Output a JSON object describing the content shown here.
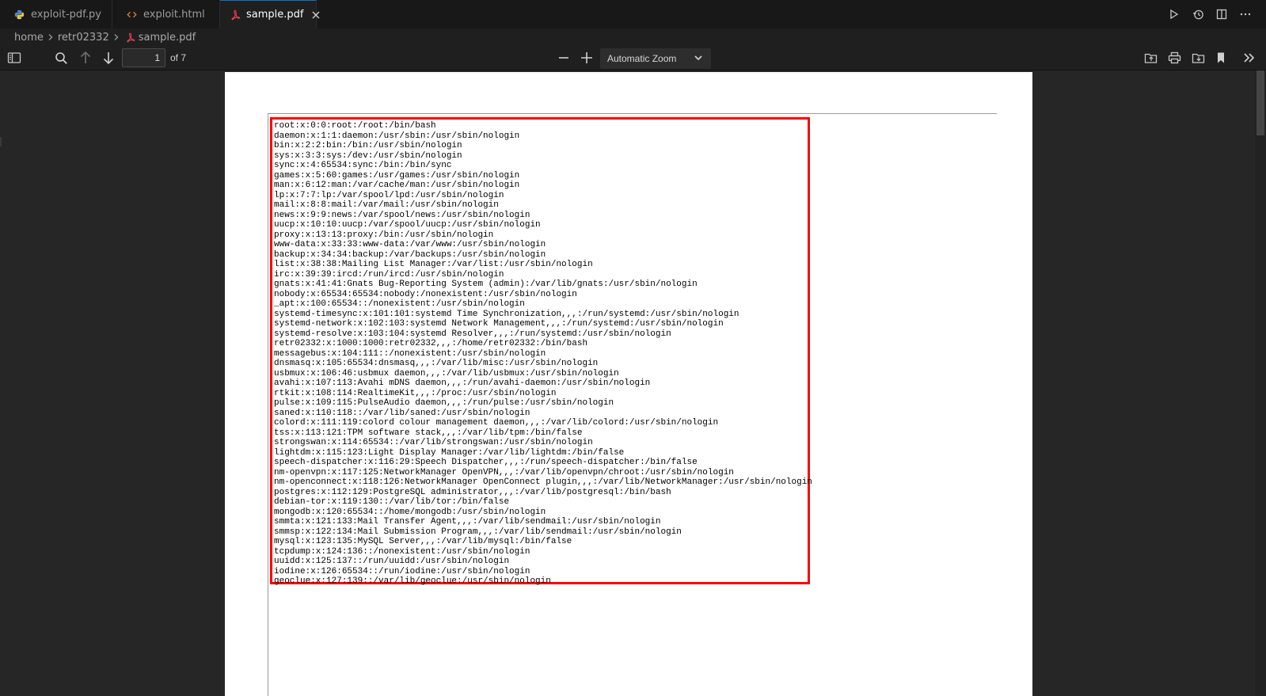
{
  "tabs": [
    {
      "label": "exploit-pdf.py",
      "icon": "python-icon",
      "active": false
    },
    {
      "label": "exploit.html",
      "icon": "code-icon",
      "active": false
    },
    {
      "label": "sample.pdf",
      "icon": "pdf-icon",
      "active": true
    }
  ],
  "breadcrumb": [
    "home",
    "retr02332",
    "sample.pdf"
  ],
  "toolbar": {
    "page_number": "1",
    "page_count_label": "of 7",
    "zoom": "Automatic Zoom"
  },
  "colors": {
    "highlight": "#ff0000",
    "pdf_icon": "#e0404a",
    "python_icon": "#4b8bd6",
    "html_icon": "#e37933"
  },
  "passwd_lines": [
    "root:x:0:0:root:/root:/bin/bash",
    "daemon:x:1:1:daemon:/usr/sbin:/usr/sbin/nologin",
    "bin:x:2:2:bin:/bin:/usr/sbin/nologin",
    "sys:x:3:3:sys:/dev:/usr/sbin/nologin",
    "sync:x:4:65534:sync:/bin:/bin/sync",
    "games:x:5:60:games:/usr/games:/usr/sbin/nologin",
    "man:x:6:12:man:/var/cache/man:/usr/sbin/nologin",
    "lp:x:7:7:lp:/var/spool/lpd:/usr/sbin/nologin",
    "mail:x:8:8:mail:/var/mail:/usr/sbin/nologin",
    "news:x:9:9:news:/var/spool/news:/usr/sbin/nologin",
    "uucp:x:10:10:uucp:/var/spool/uucp:/usr/sbin/nologin",
    "proxy:x:13:13:proxy:/bin:/usr/sbin/nologin",
    "www-data:x:33:33:www-data:/var/www:/usr/sbin/nologin",
    "backup:x:34:34:backup:/var/backups:/usr/sbin/nologin",
    "list:x:38:38:Mailing List Manager:/var/list:/usr/sbin/nologin",
    "irc:x:39:39:ircd:/run/ircd:/usr/sbin/nologin",
    "gnats:x:41:41:Gnats Bug-Reporting System (admin):/var/lib/gnats:/usr/sbin/nologin",
    "nobody:x:65534:65534:nobody:/nonexistent:/usr/sbin/nologin",
    "_apt:x:100:65534::/nonexistent:/usr/sbin/nologin",
    "systemd-timesync:x:101:101:systemd Time Synchronization,,,:/run/systemd:/usr/sbin/nologin",
    "systemd-network:x:102:103:systemd Network Management,,,:/run/systemd:/usr/sbin/nologin",
    "systemd-resolve:x:103:104:systemd Resolver,,,:/run/systemd:/usr/sbin/nologin",
    "retr02332:x:1000:1000:retr02332,,,:/home/retr02332:/bin/bash",
    "messagebus:x:104:111::/nonexistent:/usr/sbin/nologin",
    "dnsmasq:x:105:65534:dnsmasq,,,:/var/lib/misc:/usr/sbin/nologin",
    "usbmux:x:106:46:usbmux daemon,,,:/var/lib/usbmux:/usr/sbin/nologin",
    "avahi:x:107:113:Avahi mDNS daemon,,,:/run/avahi-daemon:/usr/sbin/nologin",
    "rtkit:x:108:114:RealtimeKit,,,:/proc:/usr/sbin/nologin",
    "pulse:x:109:115:PulseAudio daemon,,,:/run/pulse:/usr/sbin/nologin",
    "saned:x:110:118::/var/lib/saned:/usr/sbin/nologin",
    "colord:x:111:119:colord colour management daemon,,,:/var/lib/colord:/usr/sbin/nologin",
    "tss:x:113:121:TPM software stack,,,:/var/lib/tpm:/bin/false",
    "strongswan:x:114:65534::/var/lib/strongswan:/usr/sbin/nologin",
    "lightdm:x:115:123:Light Display Manager:/var/lib/lightdm:/bin/false",
    "speech-dispatcher:x:116:29:Speech Dispatcher,,,:/run/speech-dispatcher:/bin/false",
    "nm-openvpn:x:117:125:NetworkManager OpenVPN,,,:/var/lib/openvpn/chroot:/usr/sbin/nologin",
    "nm-openconnect:x:118:126:NetworkManager OpenConnect plugin,,,:/var/lib/NetworkManager:/usr/sbin/nologin",
    "postgres:x:112:129:PostgreSQL administrator,,,:/var/lib/postgresql:/bin/bash",
    "debian-tor:x:119:130::/var/lib/tor:/bin/false",
    "mongodb:x:120:65534::/home/mongodb:/usr/sbin/nologin",
    "smmta:x:121:133:Mail Transfer Agent,,,:/var/lib/sendmail:/usr/sbin/nologin",
    "smmsp:x:122:134:Mail Submission Program,,,:/var/lib/sendmail:/usr/sbin/nologin",
    "mysql:x:123:135:MySQL Server,,,:/var/lib/mysql:/bin/false",
    "tcpdump:x:124:136::/nonexistent:/usr/sbin/nologin",
    "uuidd:x:125:137::/run/uuidd:/usr/sbin/nologin",
    "iodine:x:126:65534::/run/iodine:/usr/sbin/nologin",
    "geoclue:x:127:139::/var/lib/geoclue:/usr/sbin/nologin"
  ]
}
